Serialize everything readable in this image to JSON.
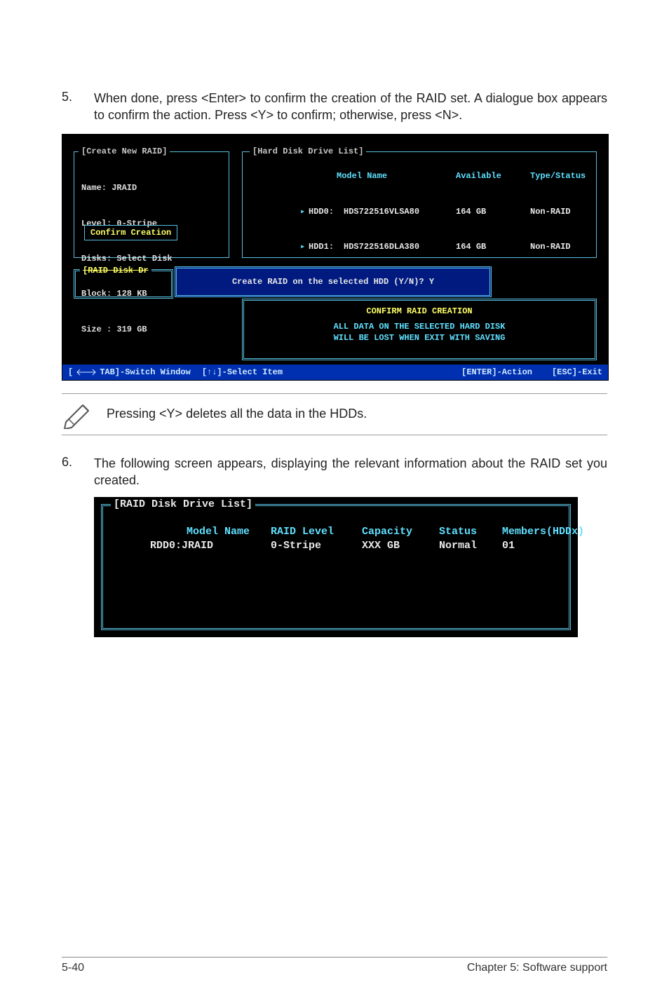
{
  "step5": {
    "num": "5.",
    "text": "When done, press <Enter> to confirm the creation of the RAID set. A dialogue box appears to confirm the action. Press <Y> to confirm; otherwise, press <N>."
  },
  "term1": {
    "createTitle": "[Create New RAID]",
    "hddTitle": "[Hard Disk Drive List]",
    "raidDiskTitle": "[RAID Disk Dr",
    "name": "Name: JRAID",
    "level": "Level: 0-Stripe",
    "disks": "Disks: Select Disk",
    "block": "Block: 128 KB",
    "size": "Size : 319 GB",
    "confirm": "Confirm Creation",
    "hddHead": {
      "model": "Model Name",
      "avail": "Available",
      "type": "Type/Status"
    },
    "hdd0": {
      "p": "HDD0:",
      "m": "HDS722516VLSA80",
      "a": "164 GB",
      "t": "Non-RAID"
    },
    "hdd1": {
      "p": "HDD1:",
      "m": "HDS722516DLA380",
      "a": "164 GB",
      "t": "Non-RAID"
    },
    "dlg": "Create RAID on the selected HDD (Y/N)? Y",
    "confirmCreation": "CONFIRM RAID CREATION",
    "warn1": "ALL DATA ON THE SELECTED HARD DISK",
    "warn2": "WILL BE LOST WHEN EXIT WITH SAVING",
    "foot": {
      "tab": "TAB]-Switch Window",
      "sel": "[↑↓]-Select Item",
      "enter": "[ENTER]-Action",
      "esc": "[ESC]-Exit"
    }
  },
  "note": "Pressing <Y> deletes all the data in the HDDs.",
  "step6": {
    "num": "6.",
    "text": "The following screen appears, displaying the relevant information about the RAID set you created."
  },
  "term2": {
    "title": "[RAID Disk Drive List]",
    "head": {
      "model": "Model Name",
      "level": "RAID Level",
      "cap": "Capacity",
      "status": "Status",
      "mem": "Members(HDDx)"
    },
    "row": {
      "model": "RDD0:JRAID",
      "level": "0-Stripe",
      "cap": "XXX GB",
      "status": "Normal",
      "mem": "01"
    }
  },
  "footer": {
    "left": "5-40",
    "right": "Chapter 5: Software support"
  }
}
